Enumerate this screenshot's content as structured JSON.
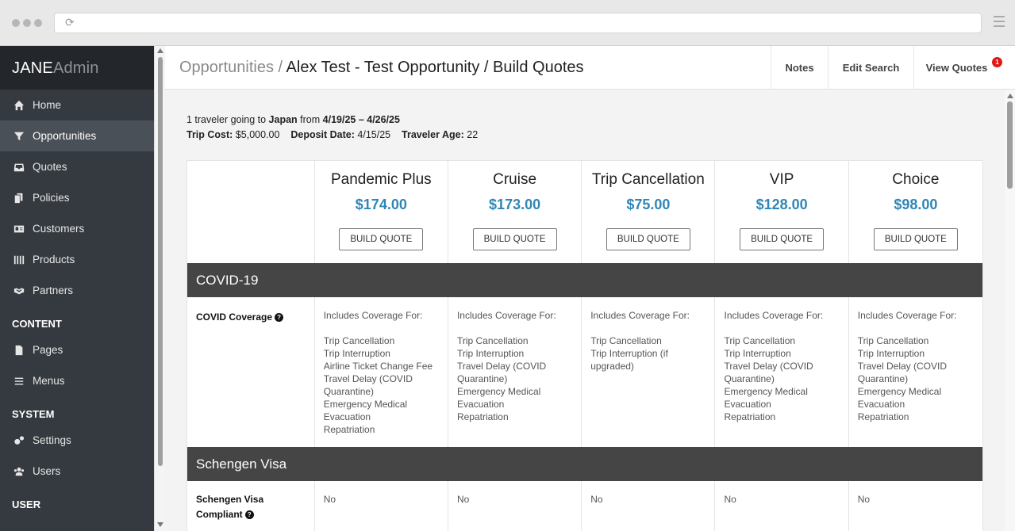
{
  "app": {
    "brand_a": "JANE",
    "brand_b": "Admin"
  },
  "sidebar": {
    "items": [
      {
        "label": "Home",
        "icon": "home-icon"
      },
      {
        "label": "Opportunities",
        "icon": "filter-icon",
        "active": true
      },
      {
        "label": "Quotes",
        "icon": "inbox-icon"
      },
      {
        "label": "Policies",
        "icon": "copy-icon"
      },
      {
        "label": "Customers",
        "icon": "id-card-icon"
      },
      {
        "label": "Products",
        "icon": "columns-icon"
      },
      {
        "label": "Partners",
        "icon": "handshake-icon"
      }
    ],
    "content_label": "CONTENT",
    "content_items": [
      {
        "label": "Pages",
        "icon": "file-icon"
      },
      {
        "label": "Menus",
        "icon": "bars-icon"
      }
    ],
    "system_label": "SYSTEM",
    "system_items": [
      {
        "label": "Settings",
        "icon": "gears-icon"
      },
      {
        "label": "Users",
        "icon": "users-icon"
      }
    ],
    "user_label": "USER"
  },
  "header": {
    "crumb_parent": "Opportunities /",
    "crumb_current": "Alex Test - Test Opportunity / Build Quotes",
    "notes": "Notes",
    "edit_search": "Edit Search",
    "view_quotes": "View Quotes",
    "view_quotes_badge": "1"
  },
  "trip": {
    "line1_a": "1 traveler going to ",
    "destination": "Japan",
    "line1_b": " from ",
    "date_range": "4/19/25 – 4/26/25",
    "trip_cost_label": "Trip Cost:",
    "trip_cost": " $5,000.00",
    "deposit_label": "Deposit Date:",
    "deposit_date": " 4/15/25",
    "age_label": "Traveler Age:",
    "age": " 22"
  },
  "plans": [
    {
      "name": "Pandemic Plus",
      "price": "$174.00",
      "button": "BUILD QUOTE"
    },
    {
      "name": "Cruise",
      "price": "$173.00",
      "button": "BUILD QUOTE"
    },
    {
      "name": "Trip Cancellation",
      "price": "$75.00",
      "button": "BUILD QUOTE"
    },
    {
      "name": "VIP",
      "price": "$128.00",
      "button": "BUILD QUOTE"
    },
    {
      "name": "Choice",
      "price": "$98.00",
      "button": "BUILD QUOTE"
    }
  ],
  "sections": {
    "covid": {
      "title": "COVID-19",
      "feature": "COVID Coverage",
      "header": "Includes Coverage For:",
      "values": [
        [
          "Trip Cancellation",
          "Trip Interruption",
          "Airline Ticket Change Fee",
          "Travel Delay (COVID Quarantine)",
          "Emergency Medical Evacuation",
          "Repatriation"
        ],
        [
          "Trip Cancellation",
          "Trip Interruption",
          "Travel Delay (COVID Quarantine)",
          "Emergency Medical Evacuation",
          "Repatriation"
        ],
        [
          "Trip Cancellation",
          "Trip Interruption (if upgraded)"
        ],
        [
          "Trip Cancellation",
          "Trip Interruption",
          "Travel Delay (COVID Quarantine)",
          "Emergency Medical Evacuation",
          "Repatriation"
        ],
        [
          "Trip Cancellation",
          "Trip Interruption",
          "Travel Delay (COVID Quarantine)",
          "Emergency Medical Evacuation",
          "Repatriation"
        ]
      ]
    },
    "visa": {
      "title": "Schengen Visa",
      "feature": "Schengen Visa Compliant",
      "values": [
        "No",
        "No",
        "No",
        "No",
        "No"
      ]
    }
  },
  "colors": {
    "price": "#2f86b7",
    "sidebar": "#353a40",
    "section_bar": "#454545",
    "badge": "#e01818"
  }
}
